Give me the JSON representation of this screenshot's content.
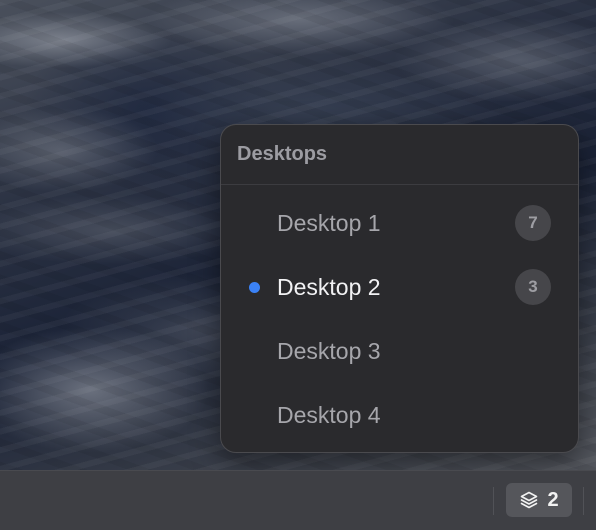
{
  "popup": {
    "title": "Desktops",
    "desktops": [
      {
        "label": "Desktop 1",
        "window_count": "7",
        "active": false
      },
      {
        "label": "Desktop 2",
        "window_count": "3",
        "active": true
      },
      {
        "label": "Desktop 3",
        "window_count": "",
        "active": false
      },
      {
        "label": "Desktop 4",
        "window_count": "",
        "active": false
      }
    ]
  },
  "taskbar": {
    "desktop_switcher": {
      "icon": "layers-icon",
      "count": "2"
    }
  },
  "colors": {
    "active_indicator": "#3b82f6",
    "popup_background": "#2a2a2d",
    "taskbar_background": "#3e3f44"
  }
}
